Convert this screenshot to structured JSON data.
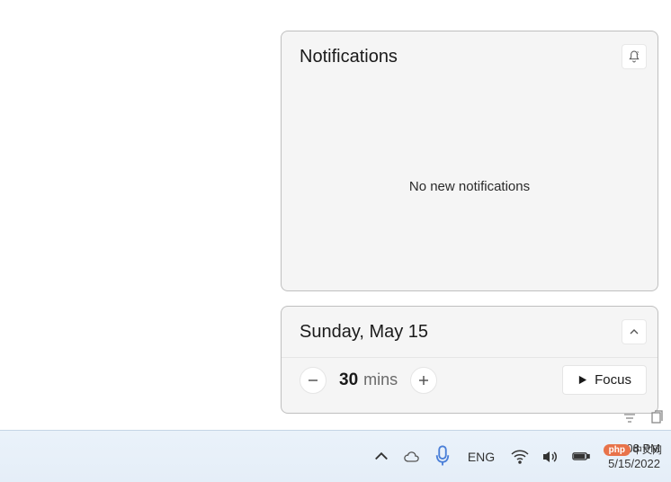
{
  "notifications": {
    "title": "Notifications",
    "empty_message": "No new notifications"
  },
  "calendar": {
    "date_label": "Sunday, May 15"
  },
  "focus": {
    "duration_value": "30",
    "duration_unit": "mins",
    "button_label": "Focus"
  },
  "taskbar": {
    "language": "ENG",
    "time": "12:08 PM",
    "date": "5/15/2022"
  },
  "watermark": {
    "badge": "php",
    "text": "中文网"
  }
}
